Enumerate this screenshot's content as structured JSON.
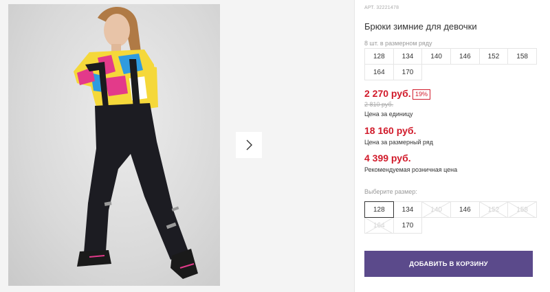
{
  "product": {
    "article": "АРТ. 32221478",
    "title": "Брюки зимние для девочки",
    "pack_hint": "8 шт. в размерном ряду",
    "pack_sizes": [
      "128",
      "134",
      "140",
      "146",
      "152",
      "158",
      "164",
      "170"
    ],
    "price": "2 270 руб.",
    "discount_badge": "19%",
    "old_price": "2 810 руб.",
    "unit_label": "Цена за единицу",
    "row_price": "18 160 руб.",
    "row_label": "Цена за размерный ряд",
    "retail_price": "4 399 руб.",
    "retail_label": "Рекомендуемая розничная цена",
    "choose_label": "Выберите размер:",
    "sizes": [
      {
        "label": "128",
        "state": "selected"
      },
      {
        "label": "134",
        "state": "available"
      },
      {
        "label": "140",
        "state": "disabled"
      },
      {
        "label": "146",
        "state": "available"
      },
      {
        "label": "152",
        "state": "disabled"
      },
      {
        "label": "158",
        "state": "disabled"
      },
      {
        "label": "164",
        "state": "disabled"
      },
      {
        "label": "170",
        "state": "available"
      }
    ],
    "cart_button": "ДОБАВИТЬ В КОРЗИНУ"
  },
  "colors": {
    "price_red": "#d11a2a",
    "cart_purple": "#5b4a8b"
  },
  "icons": {
    "gallery_next": "chevron-right-icon"
  }
}
